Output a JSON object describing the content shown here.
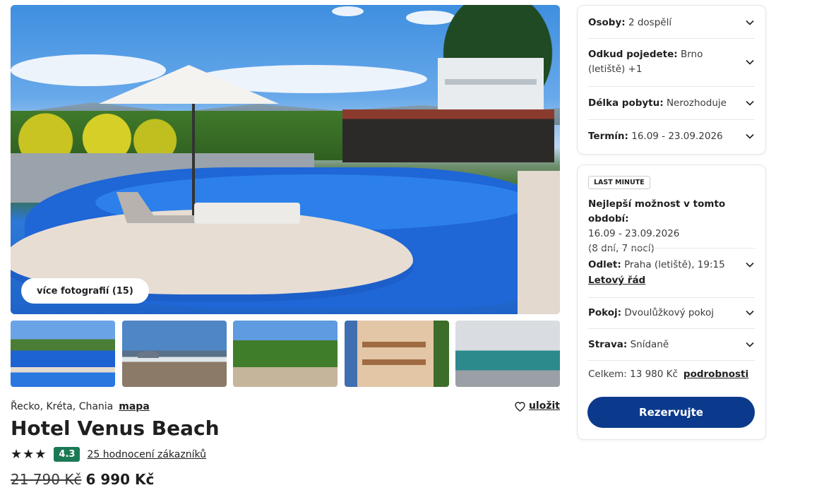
{
  "gallery": {
    "more_photos_label": "více fotografií (15)"
  },
  "hotel": {
    "location": "Řecko, Kréta, Chania",
    "map_label": "mapa",
    "save_label": "uložit",
    "name": "Hotel Venus Beach",
    "stars": 3,
    "stars_text": "★★★",
    "score": "4.3",
    "reviews_label": "25 hodnocení zákazníků",
    "old_price": "21 790 Kč",
    "new_price": "6 990 Kč"
  },
  "search": {
    "persons_label": "Osoby:",
    "persons_value": "2 dospělí",
    "departure_label": "Odkud pojedete:",
    "departure_value": "Brno (letiště) +1",
    "departure_value_line1": "Brno",
    "departure_value_line2": "(letiště) +1",
    "duration_label": "Délka pobytu:",
    "duration_value": "Nerozhoduje",
    "date_label": "Termín:",
    "date_value": "16.09 - 23.09.2026"
  },
  "offer": {
    "badge": "LAST MINUTE",
    "best_title": "Nejlepší možnost v tomto období:",
    "best_dates": "16.09 - 23.09.2026",
    "best_nights": "(8 dní, 7 nocí)",
    "flight_label": "Odlet:",
    "flight_value": "Praha (letiště), 19:15",
    "flight_link": "Letový řád",
    "room_label": "Pokoj:",
    "room_value": "Dvoulůžkový pokoj",
    "board_label": "Strava:",
    "board_value": "Snídaně",
    "total_label": "Celkem: 13 980 Kč",
    "details_label": "podrobnosti",
    "book_label": "Rezervujte"
  },
  "colors": {
    "primary_button": "#0b3a8c",
    "score_badge": "#1b7a55"
  }
}
